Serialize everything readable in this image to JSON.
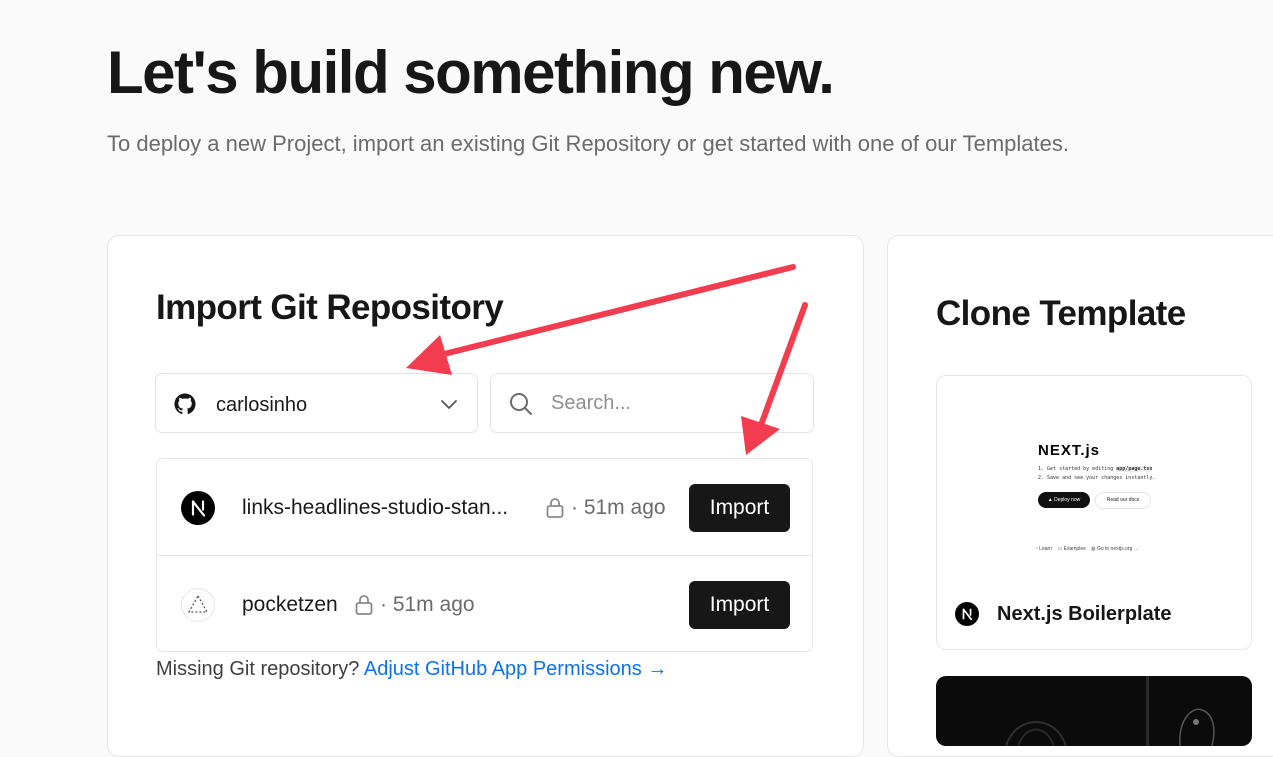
{
  "hero": {
    "title": "Let's build something new.",
    "subtitle": "To deploy a new Project, import an existing Git Repository or get started with one of our Templates."
  },
  "import_section": {
    "title": "Import Git Repository",
    "account": "carlosinho",
    "account_icon": "github-icon",
    "search_placeholder": "Search...",
    "import_label": "Import",
    "repos": [
      {
        "name": "links-headlines-studio-stan...",
        "time": "51m ago",
        "private": true,
        "icon": "nextjs-icon"
      },
      {
        "name": "pocketzen",
        "time": "51m ago",
        "private": true,
        "icon": "triangle-icon"
      }
    ],
    "missing_text": "Missing Git repository?",
    "missing_link": "Adjust GitHub App Permissions →"
  },
  "clone_section": {
    "title": "Clone Template",
    "templates": [
      {
        "name": "Next.js Boilerplate",
        "preview": {
          "logo": "NEXT.js",
          "line1_prefix": "1. Get started by editing",
          "line1_code": "app/page.tsx",
          "line2": "2. Save and see your changes instantly.",
          "deploy": "Deploy now",
          "docs": "Read our docs",
          "footer_learn": "Learn",
          "footer_examples": "Examples",
          "footer_site": "Go to nextjs.org →"
        }
      }
    ]
  },
  "colors": {
    "annotation_arrow": "#f43c4f",
    "link": "#0a72ef",
    "button_bg": "#171717"
  }
}
